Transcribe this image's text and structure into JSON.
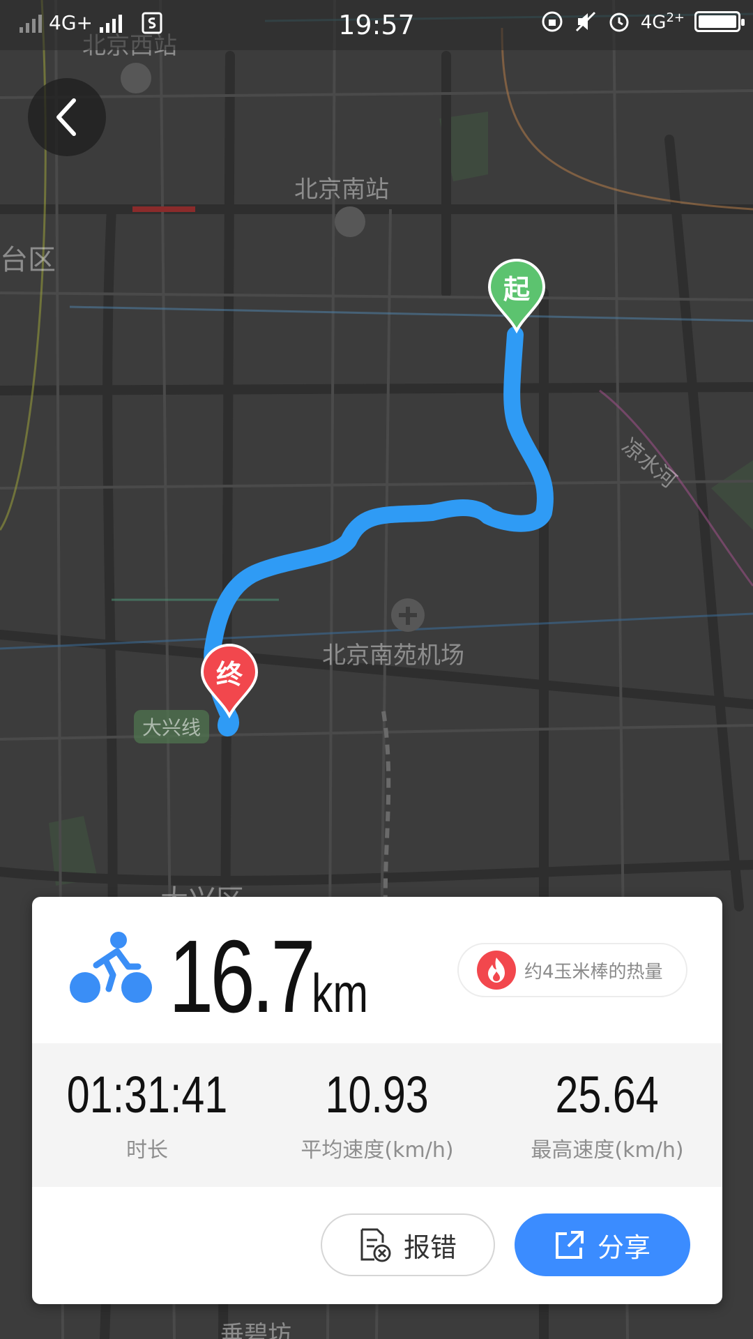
{
  "status_bar": {
    "network_left": "4G+",
    "time": "19:57",
    "network_right": "4G",
    "network_right_sub": "2+"
  },
  "map": {
    "labels": {
      "beijing_west": "北京西站",
      "beijing_south": "北京南站",
      "fengtai": "台区",
      "nanyuan_airport": "北京南苑机场",
      "liangshui_river": "凉水河",
      "daxing_district": "大兴区",
      "bottom_place": "垂碧坊"
    },
    "daxing_line_badge": "大兴线",
    "start_marker": "起",
    "end_marker": "终",
    "route_color": "#2f9bf5"
  },
  "summary": {
    "distance_value": "16.7",
    "distance_unit": "km",
    "calorie_text": "约4玉米棒的热量"
  },
  "stats": [
    {
      "value": "01:31:41",
      "label": "时长"
    },
    {
      "value": "10.93",
      "label": "平均速度(km/h)"
    },
    {
      "value": "25.64",
      "label": "最高速度(km/h)"
    }
  ],
  "actions": {
    "report_label": "报错",
    "share_label": "分享"
  },
  "colors": {
    "accent": "#3b8cff",
    "start_green": "#5cc36f",
    "end_red": "#f2474d",
    "bike_blue": "#3a8ef6"
  }
}
